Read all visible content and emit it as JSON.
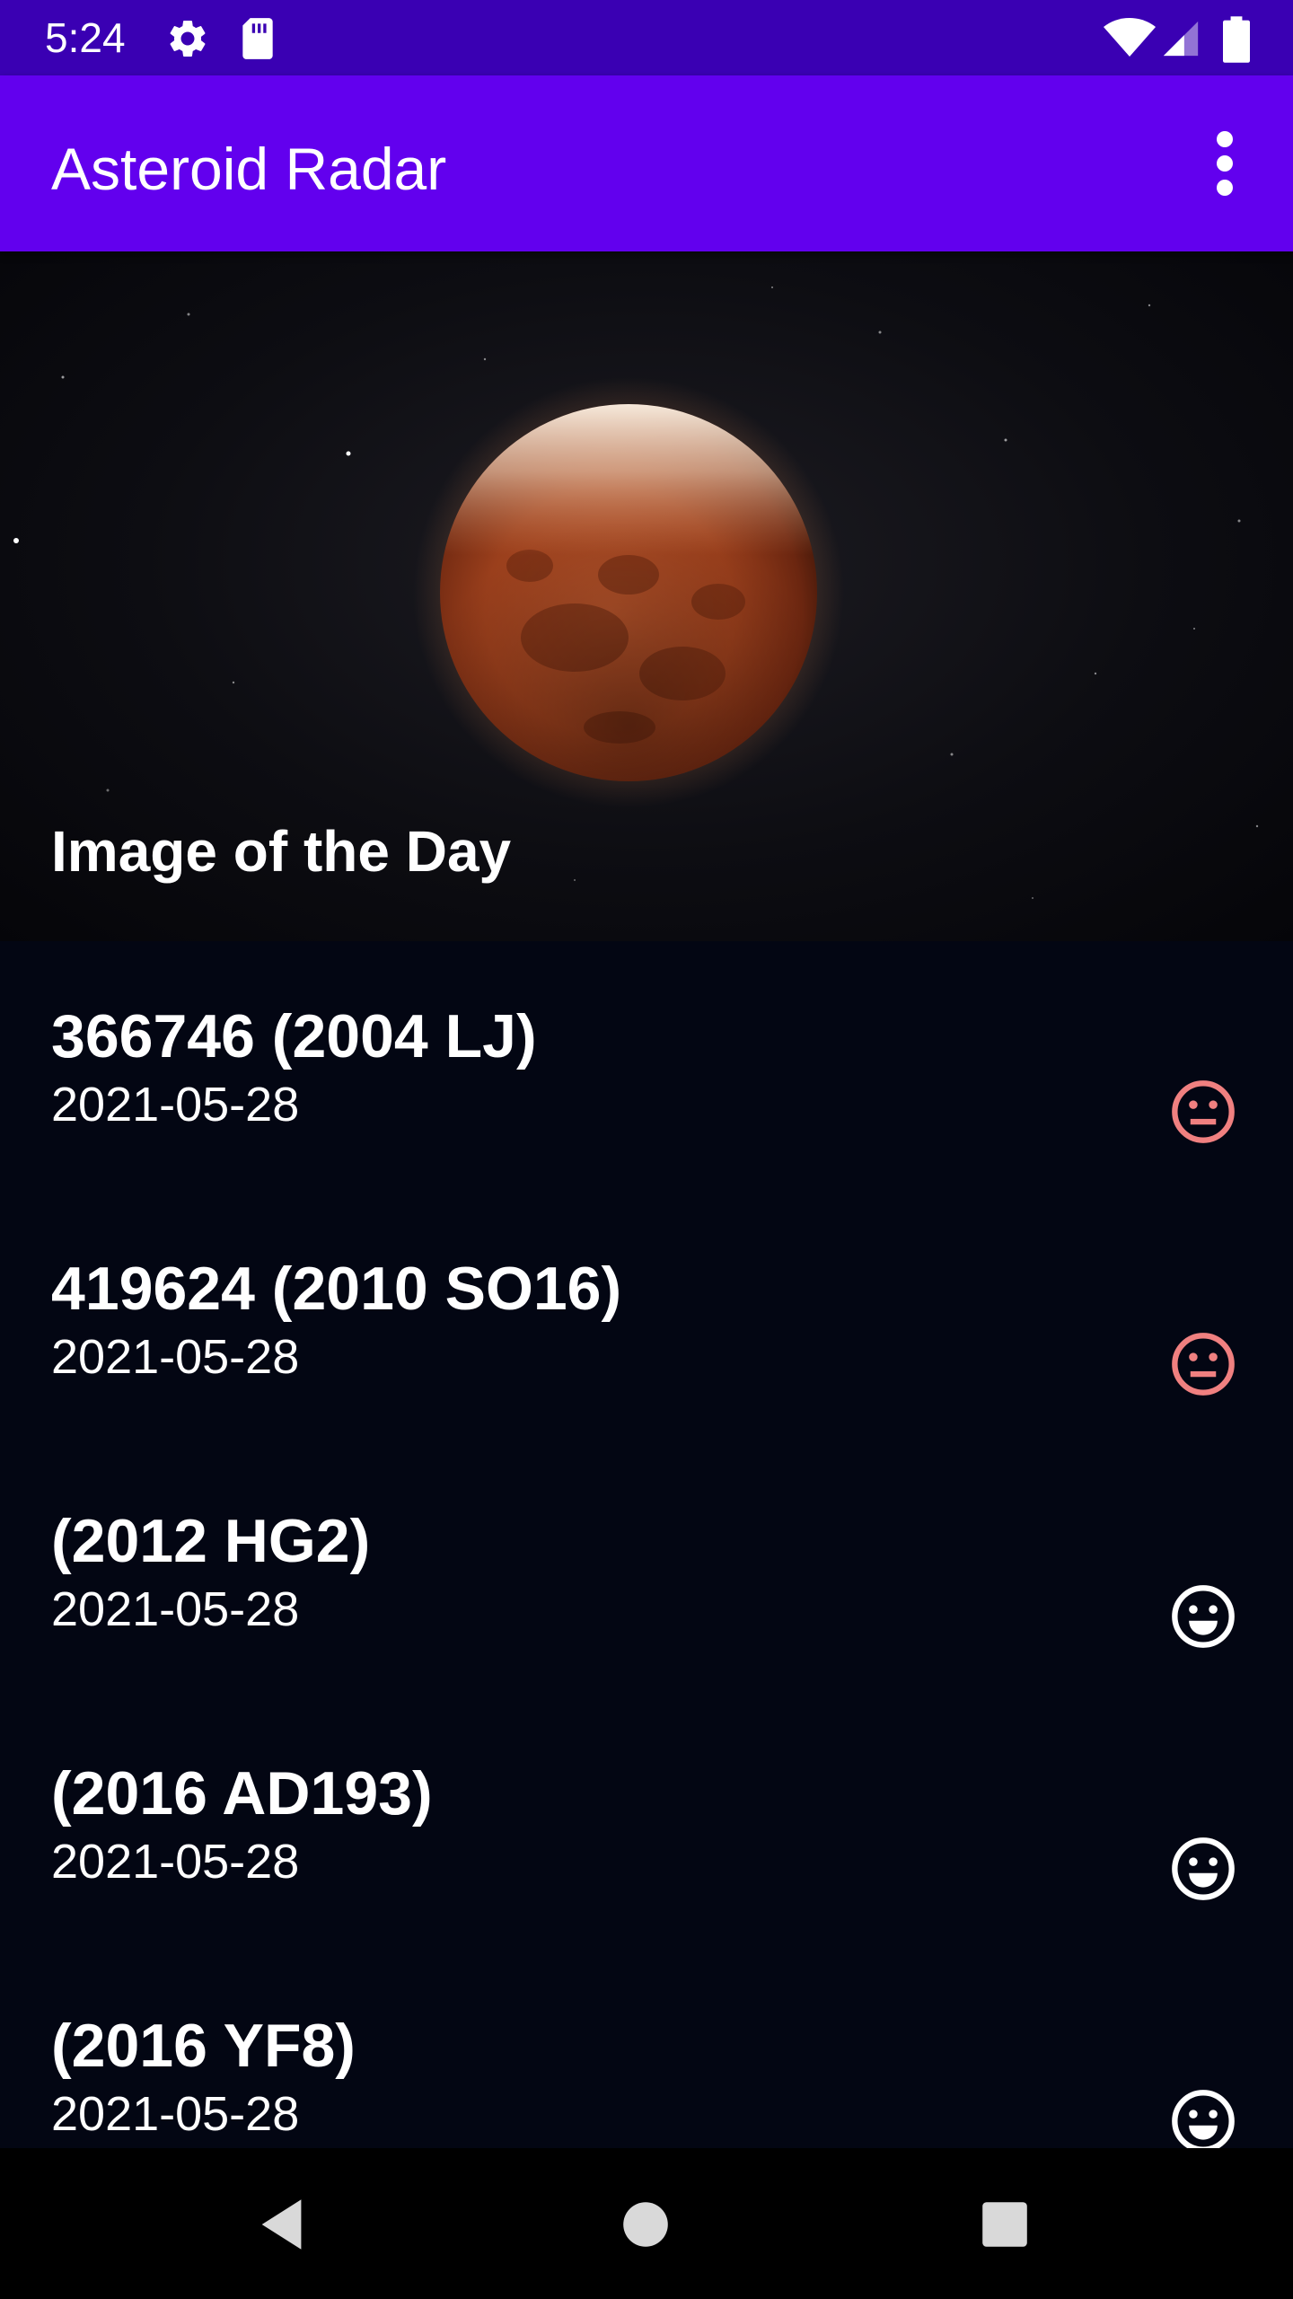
{
  "status_bar": {
    "time": "5:24",
    "icons": [
      "gear-icon",
      "sd-card-icon",
      "wifi-icon",
      "cell-signal-icon",
      "battery-icon"
    ]
  },
  "app_bar": {
    "title": "Asteroid Radar",
    "menu_icon": "overflow-menu-icon"
  },
  "image_of_the_day": {
    "title": "Image of the Day",
    "subject": "eclipsed moon"
  },
  "asteroids": [
    {
      "name": "366746 (2004 LJ)",
      "date": "2021-05-28",
      "status_icon": "neutral-face-icon",
      "hazardous": true
    },
    {
      "name": "419624 (2010 SO16)",
      "date": "2021-05-28",
      "status_icon": "neutral-face-icon",
      "hazardous": true
    },
    {
      "name": "(2012 HG2)",
      "date": "2021-05-28",
      "status_icon": "happy-face-icon",
      "hazardous": false
    },
    {
      "name": "(2016 AD193)",
      "date": "2021-05-28",
      "status_icon": "happy-face-icon",
      "hazardous": false
    },
    {
      "name": "(2016 YF8)",
      "date": "2021-05-28",
      "status_icon": "happy-face-icon",
      "hazardous": false
    }
  ],
  "colors": {
    "status_bar": "#3a00b3",
    "app_bar": "#6200ee",
    "background": "#030613",
    "hazardous": "#f08080",
    "safe": "#ffffff"
  },
  "nav_bar": {
    "icons": [
      "back-icon",
      "home-icon",
      "recents-icon"
    ]
  }
}
